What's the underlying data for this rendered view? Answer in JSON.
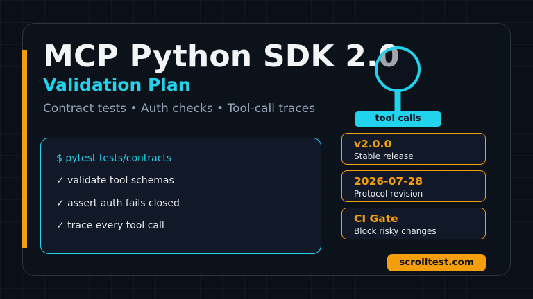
{
  "hero": {
    "title": "MCP Python SDK 2.0",
    "subtitle": "Validation Plan",
    "tagline": "Contract tests • Auth checks • Tool-call traces"
  },
  "badge": {
    "label": "tool calls",
    "icon": "magnifier-icon"
  },
  "terminal": {
    "command": "$ pytest tests/contracts",
    "checks": [
      "✓ validate tool schemas",
      "✓ assert auth fails closed",
      "✓ trace every tool call"
    ]
  },
  "info_cards": [
    {
      "value": "v2.0.0",
      "label": "Stable release"
    },
    {
      "value": "2026-07-28",
      "label": "Protocol revision"
    },
    {
      "value": "CI Gate",
      "label": "Block risky changes"
    }
  ],
  "footer": {
    "domain": "scrolltest.com"
  },
  "colors": {
    "background": "#0b0f17",
    "accent_orange": "#f59e0b",
    "accent_cyan": "#22d3ee",
    "title": "#f3f4f6",
    "muted": "#94a3b8"
  }
}
